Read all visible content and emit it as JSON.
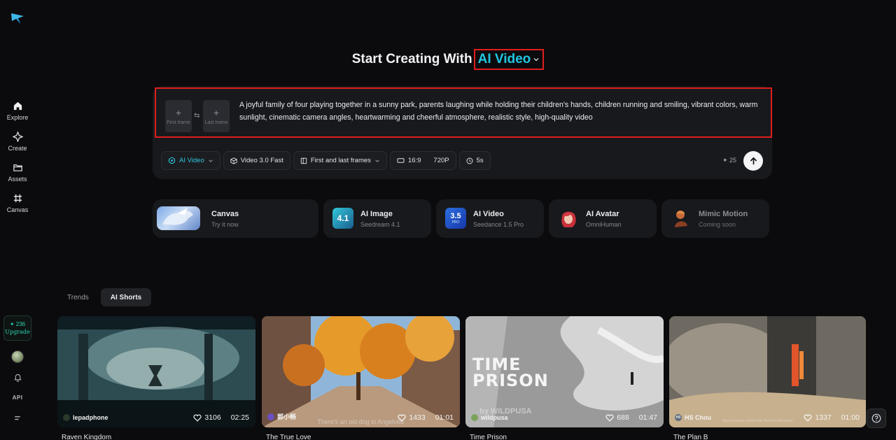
{
  "sidebar": {
    "items": [
      {
        "label": "Explore",
        "icon": "home-icon"
      },
      {
        "label": "Create",
        "icon": "sparkle-icon"
      },
      {
        "label": "Assets",
        "icon": "folder-icon"
      },
      {
        "label": "Canvas",
        "icon": "canvas-icon"
      }
    ],
    "credits": "236",
    "upgrade_label": "Upgrade",
    "api_label": "API"
  },
  "heading": {
    "prefix": "Start Creating With",
    "mode": "AI Video"
  },
  "prompt": {
    "first_frame_label": "First frame",
    "last_frame_label": "Last frame",
    "text": "A joyful family of four playing together in a sunny park, parents laughing while holding their children's hands, children running and smiling, vibrant colors, warm sunlight, cinematic camera angles, heartwarming and cheerful atmosphere, realistic style, high-quality video"
  },
  "toolbar": {
    "mode": "AI Video",
    "model": "Video 3.0 Fast",
    "reference": "First and last frames",
    "ratio": "16:9",
    "resolution": "720P",
    "duration": "5s",
    "cost": "25"
  },
  "tools": [
    {
      "name": "Canvas",
      "sub": "Try it now"
    },
    {
      "name": "AI Image",
      "sub": "Seedream 4.1",
      "badge": "4.1"
    },
    {
      "name": "AI Video",
      "sub": "Seedance 1.5 Pro",
      "badge": "3.5",
      "badge_sub": "PRO"
    },
    {
      "name": "AI Avatar",
      "sub": "OmniHuman"
    },
    {
      "name": "Mimic Motion",
      "sub": "Coming soon"
    }
  ],
  "tabs": [
    "Trends",
    "AI Shorts"
  ],
  "videos": [
    {
      "title": "Raven Kingdom",
      "author": "lepadphone",
      "likes": "3106",
      "duration": "02:25"
    },
    {
      "title": "The True Love",
      "author": "郭小畅",
      "likes": "1433",
      "duration": "01:01",
      "subtitle": "There's an old dog in Angelville"
    },
    {
      "title": "Time Prison",
      "author": "wildpusa",
      "likes": "688",
      "duration": "01:47",
      "overlay_line1": "TIME",
      "overlay_line2": "PRISON",
      "overlay_by": "by WILDPUSA"
    },
    {
      "title": "The Plan B",
      "author": "HS Chou",
      "author_initials": "HS",
      "likes": "1337",
      "duration": "01:00",
      "subtitle": "Since humans created the first tool with stone"
    }
  ]
}
